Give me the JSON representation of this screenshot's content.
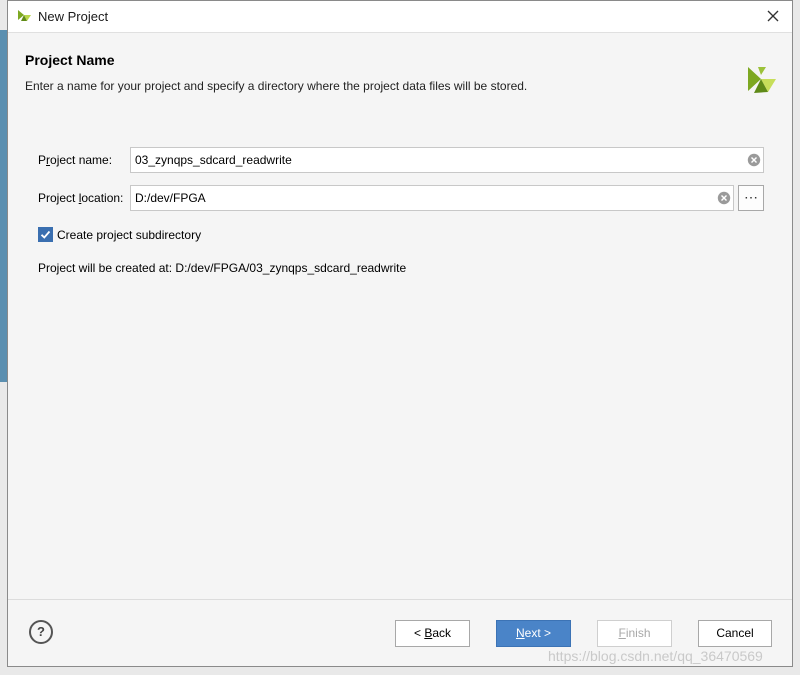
{
  "window": {
    "title": "New Project",
    "accent": "#4a84c8",
    "brand_logo": "xilinx-logo"
  },
  "page": {
    "title": "Project Name",
    "description": "Enter a name for your project and specify a directory where the project data files will be stored."
  },
  "form": {
    "project_name": {
      "label_pre": "P",
      "label_mnemonic": "r",
      "label_post": "oject name:",
      "value": "03_zynqps_sdcard_readwrite"
    },
    "project_location": {
      "label_pre": "Project ",
      "label_mnemonic": "l",
      "label_post": "ocation:",
      "value": "D:/dev/FPGA"
    },
    "browse_label": "⋯",
    "subdirectory": {
      "label": "Create project subdirectory",
      "checked": true
    },
    "created_at": "Project will be created at: D:/dev/FPGA/03_zynqps_sdcard_readwrite"
  },
  "footer": {
    "help_label": "?",
    "back": {
      "pre": "< ",
      "mnemonic": "B",
      "post": "ack"
    },
    "next": {
      "pre": "",
      "mnemonic": "N",
      "post": "ext >"
    },
    "finish": {
      "pre": "",
      "mnemonic": "F",
      "post": "inish"
    },
    "cancel": "Cancel"
  },
  "watermark": "https://blog.csdn.net/qq_36470569"
}
